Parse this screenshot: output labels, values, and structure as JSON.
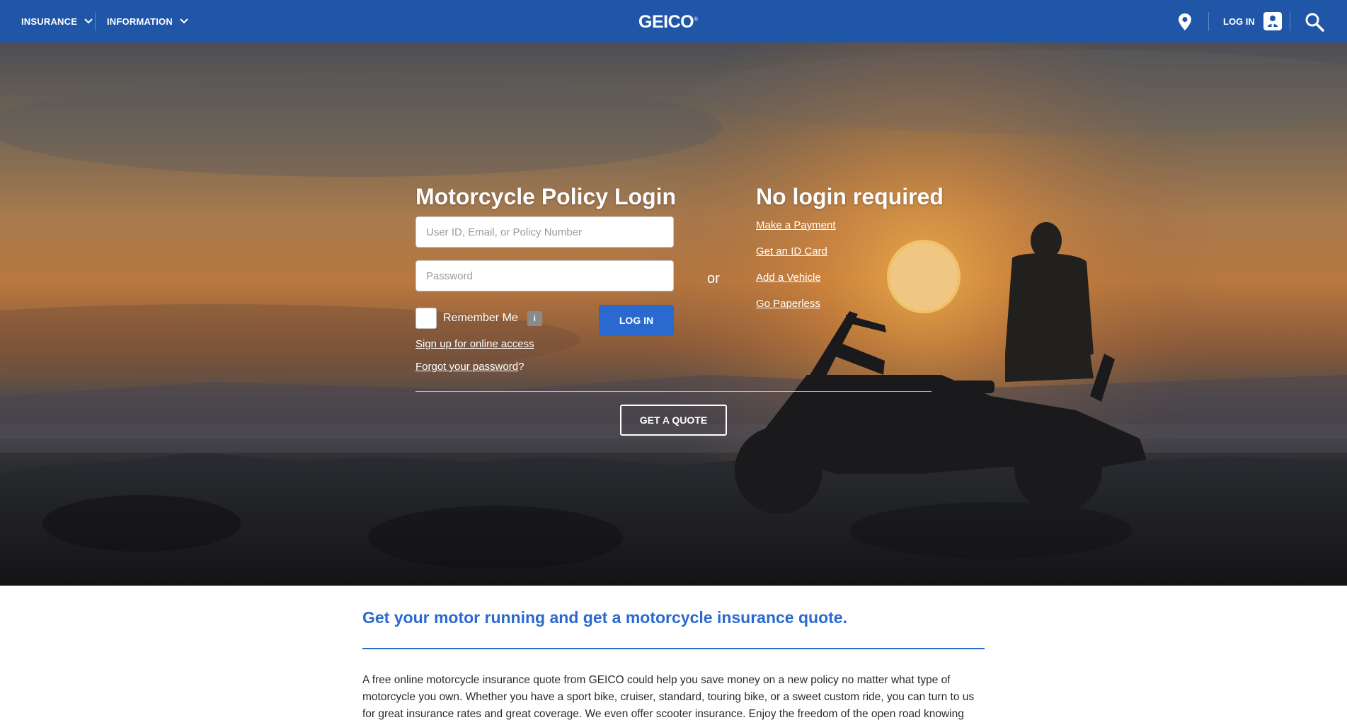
{
  "nav": {
    "insurance_label": "INSURANCE",
    "information_label": "INFORMATION",
    "logo_text": "GEICO",
    "logo_mark": "®",
    "login_label": "LOG IN",
    "icons": {
      "insurance_chevron": "chevron-down-icon",
      "information_chevron": "chevron-down-icon",
      "location": "location-pin-icon",
      "account": "user-account-icon",
      "search": "search-icon"
    }
  },
  "login": {
    "title": "Motorcycle Policy Login",
    "user_placeholder": "User ID, Email, or Policy Number",
    "password_placeholder": "Password",
    "remember_label": "Remember Me",
    "info_badge": "i",
    "login_button": "LOG IN",
    "signup_link": "Sign up for online access",
    "forgot_link": "Forgot your password",
    "forgot_suffix": "?"
  },
  "or_label": "or",
  "no_login": {
    "title": "No login required",
    "links": [
      "Make a Payment",
      "Get an ID Card",
      "Add a Vehicle",
      "Go Paperless"
    ]
  },
  "quote_button": "GET A QUOTE",
  "content": {
    "heading": "Get your motor running and get a motorcycle insurance quote.",
    "body": "A free online motorcycle insurance quote from GEICO could help you save money on a new policy no matter what type of motorcycle you own. Whether you have a sport bike, cruiser, standard, touring bike, or a sweet custom ride, you can turn to us for great insurance rates and great coverage. We even offer scooter insurance. Enjoy the freedom of the open road knowing"
  },
  "colors": {
    "nav_bg": "#1f56a8",
    "accent_blue": "#2a6ad0",
    "body_text": "#2b2b2b"
  }
}
